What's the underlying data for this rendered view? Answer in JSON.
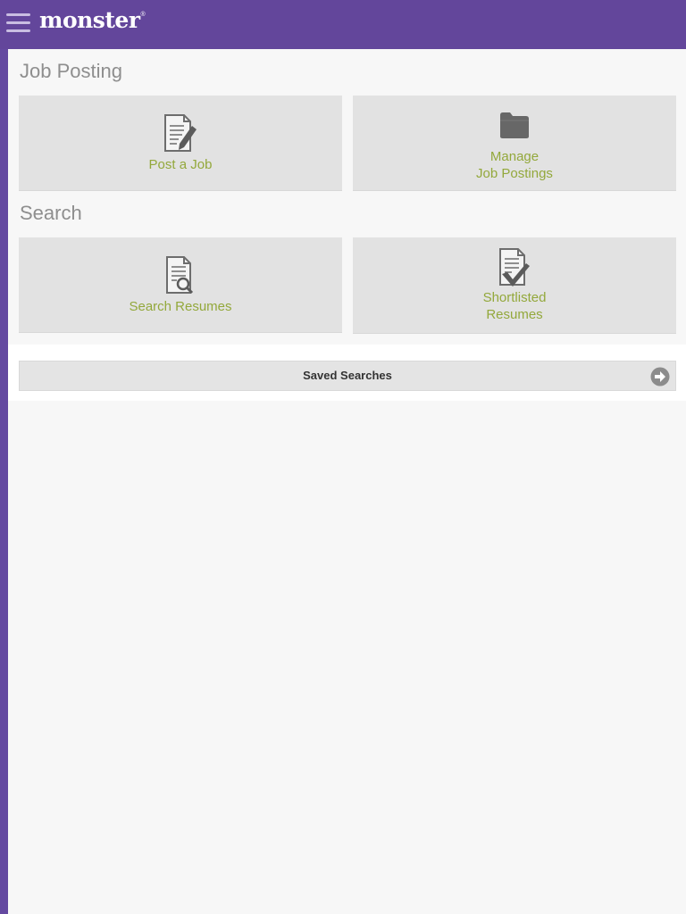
{
  "header": {
    "logo_text": "monster",
    "logo_mark": "®",
    "menu_icon": "hamburger-menu-icon"
  },
  "job_posting": {
    "title": "Job Posting",
    "tiles": [
      {
        "label": "Post a Job",
        "icon": "document-edit-icon"
      },
      {
        "label": "Manage\nJob Postings",
        "icon": "folder-icon"
      }
    ]
  },
  "search": {
    "title": "Search",
    "tiles": [
      {
        "label": "Search Resumes",
        "icon": "document-search-icon"
      },
      {
        "label": "Shortlisted\nResumes",
        "icon": "document-check-icon"
      }
    ]
  },
  "saved_searches": {
    "label": "Saved Searches",
    "icon": "arrow-right-circle-icon"
  },
  "colors": {
    "brand_purple": "#63469b",
    "tile_label_green": "#93a83b",
    "section_title_gray": "#8e8e8e",
    "tile_bg": "#e2e2e2"
  }
}
